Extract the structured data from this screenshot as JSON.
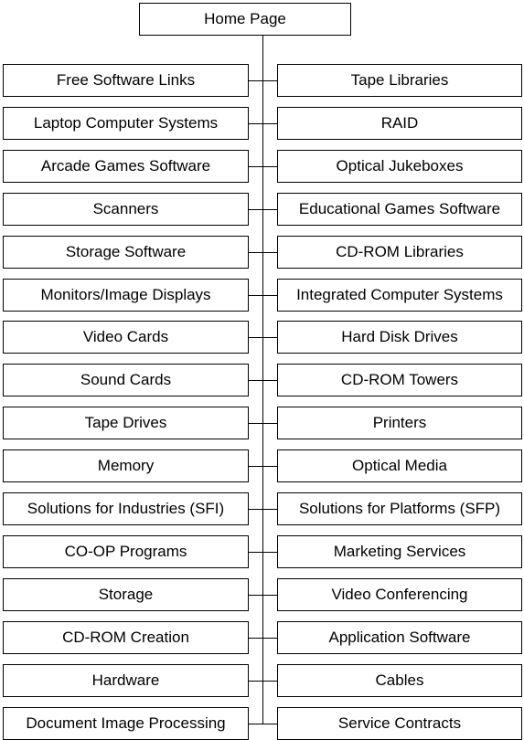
{
  "root": {
    "label": "Home Page"
  },
  "rows": [
    {
      "left": "Free Software Links",
      "right": "Tape Libraries"
    },
    {
      "left": "Laptop Computer Systems",
      "right": "RAID"
    },
    {
      "left": "Arcade Games Software",
      "right": "Optical Jukeboxes"
    },
    {
      "left": "Scanners",
      "right": "Educational Games Software"
    },
    {
      "left": "Storage Software",
      "right": "CD-ROM Libraries"
    },
    {
      "left": "Monitors/Image Displays",
      "right": "Integrated Computer Systems"
    },
    {
      "left": "Video Cards",
      "right": "Hard Disk Drives"
    },
    {
      "left": "Sound Cards",
      "right": "CD-ROM Towers"
    },
    {
      "left": "Tape Drives",
      "right": "Printers"
    },
    {
      "left": "Memory",
      "right": "Optical Media"
    },
    {
      "left": "Solutions for Industries (SFI)",
      "right": "Solutions for Platforms (SFP)"
    },
    {
      "left": "CO-OP Programs",
      "right": "Marketing Services"
    },
    {
      "left": "Storage",
      "right": "Video Conferencing"
    },
    {
      "left": "CD-ROM Creation",
      "right": "Application Software"
    },
    {
      "left": "Hardware",
      "right": "Cables"
    },
    {
      "left": "Document Image Processing",
      "right": "Service Contracts"
    }
  ]
}
